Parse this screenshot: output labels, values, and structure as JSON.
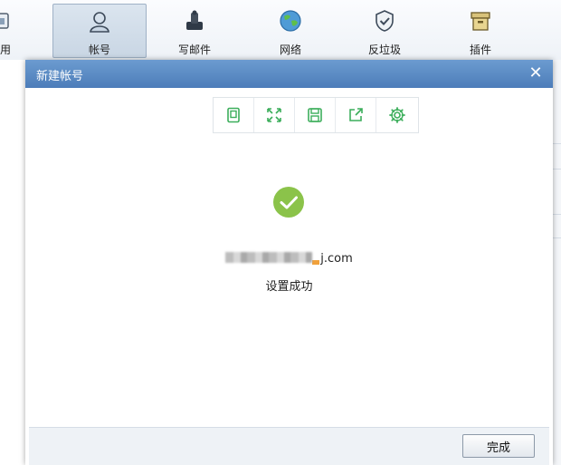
{
  "toolbar": {
    "items": [
      {
        "label": "常用",
        "icon": "calendar-icon"
      },
      {
        "label": "帐号",
        "icon": "user-icon",
        "active": true
      },
      {
        "label": "写邮件",
        "icon": "compose-icon"
      },
      {
        "label": "网络",
        "icon": "globe-icon"
      },
      {
        "label": "反垃圾",
        "icon": "shield-icon"
      },
      {
        "label": "插件",
        "icon": "box-icon"
      }
    ]
  },
  "dialog": {
    "title": "新建帐号",
    "close": "✕",
    "email_suffix": "j.com",
    "status": "设置成功",
    "finish_label": "完成"
  },
  "colors": {
    "title_bar": "#5a8ac4",
    "success_green": "#8bc34a",
    "icon_green": "#3cae5b"
  }
}
